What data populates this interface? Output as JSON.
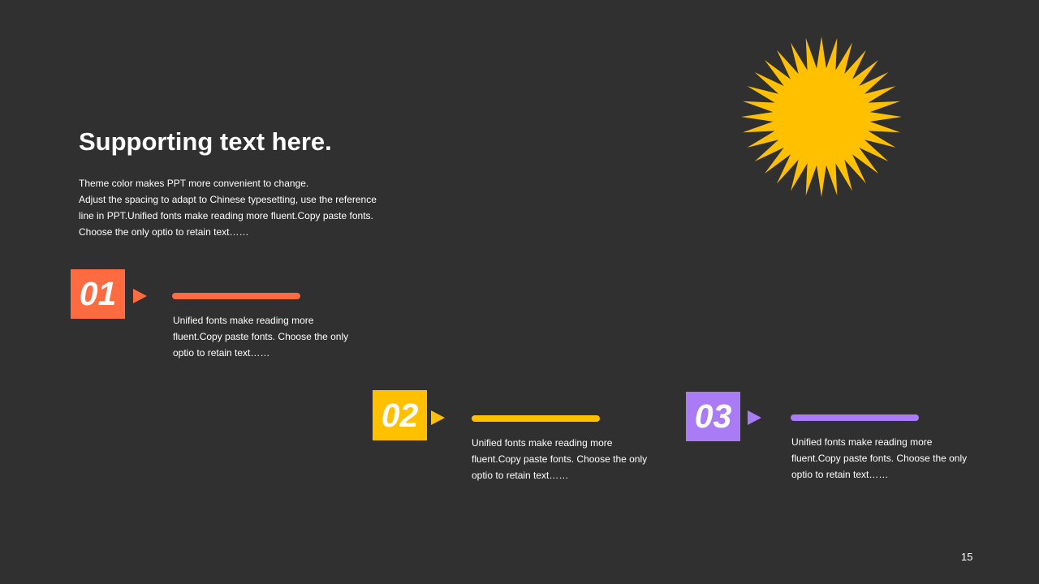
{
  "slide": {
    "title": "Supporting text here.",
    "intro_lines": [
      "Theme  color makes PPT more convenient to change.",
      "Adjust the spacing to adapt to Chinese typesetting, use the reference",
      "line in PPT.Unified fonts make reading more fluent.Copy paste fonts.",
      "Choose the only optio to retain text……"
    ],
    "page_number": "15"
  },
  "steps": [
    {
      "number": "01",
      "color": "#FF6B40",
      "lines": [
        "Unified fonts make reading more",
        "fluent.Copy paste fonts. Choose the only",
        "optio to retain text……"
      ]
    },
    {
      "number": "02",
      "color": "#FFC000",
      "lines": [
        "Unified fonts make reading more",
        "fluent.Copy paste fonts. Choose the only",
        "optio to retain text……"
      ]
    },
    {
      "number": "03",
      "color": "#A97CF5",
      "lines": [
        "Unified fonts make reading more",
        "fluent.Copy paste fonts. Choose the only",
        "optio to retain text……"
      ]
    }
  ],
  "decoration": {
    "sun_icon": "sun-burst-icon",
    "sun_color": "#FFC000"
  }
}
